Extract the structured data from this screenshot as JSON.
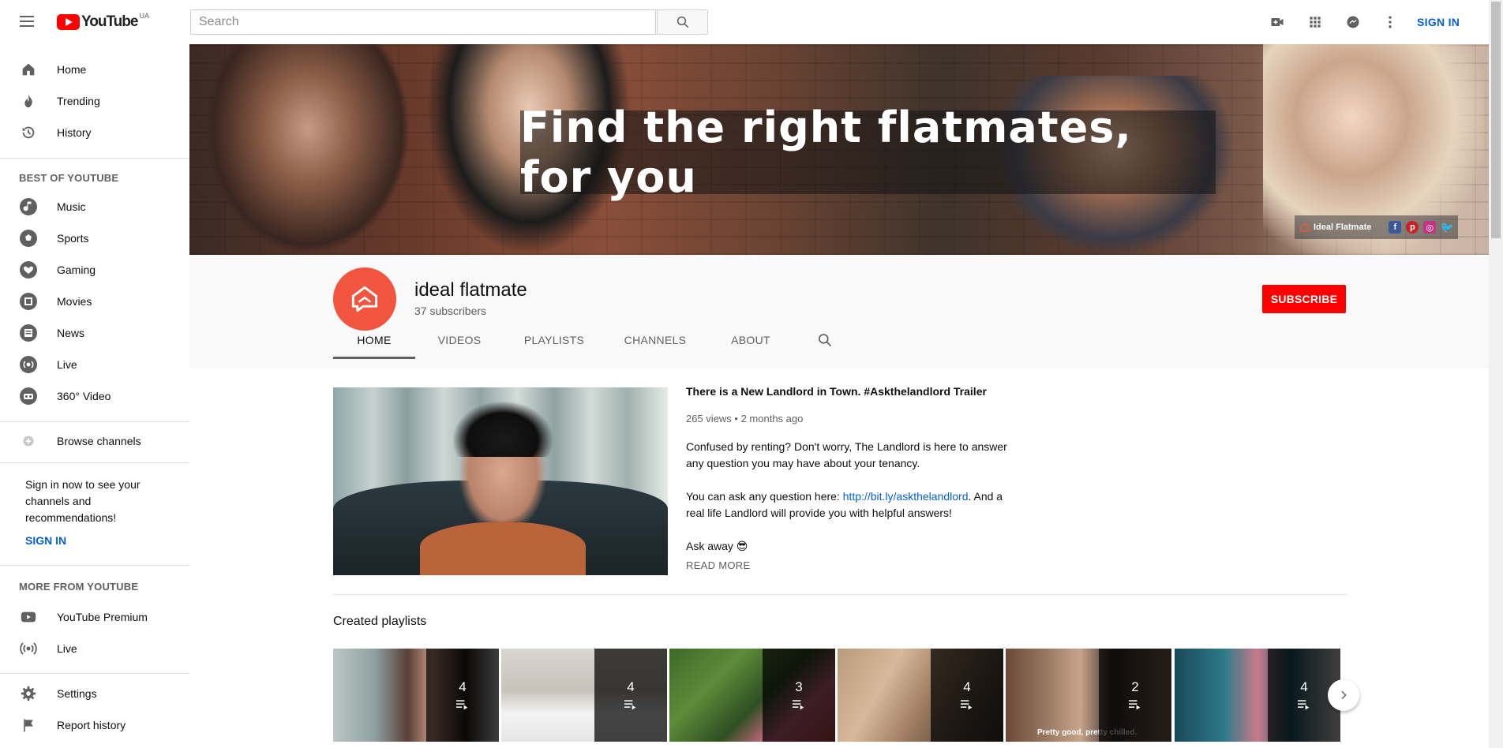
{
  "header": {
    "logo_text": "YouTube",
    "country_code": "UA",
    "search_placeholder": "Search",
    "sign_in": "SIGN IN",
    "icons": [
      "menu-icon",
      "search-icon",
      "create-video-icon",
      "apps-icon",
      "messages-icon",
      "more-vert-icon"
    ]
  },
  "sidebar": {
    "main": [
      {
        "label": "Home",
        "icon": "home-icon"
      },
      {
        "label": "Trending",
        "icon": "trending-icon"
      },
      {
        "label": "History",
        "icon": "history-icon"
      }
    ],
    "best_heading": "BEST OF YOUTUBE",
    "best": [
      {
        "label": "Music",
        "icon": "music-icon"
      },
      {
        "label": "Sports",
        "icon": "sports-icon"
      },
      {
        "label": "Gaming",
        "icon": "gaming-icon"
      },
      {
        "label": "Movies",
        "icon": "movies-icon"
      },
      {
        "label": "News",
        "icon": "news-icon"
      },
      {
        "label": "Live",
        "icon": "live-icon"
      },
      {
        "label": "360° Video",
        "icon": "vr-icon"
      }
    ],
    "browse": {
      "label": "Browse channels",
      "icon": "add-circle-icon"
    },
    "signin_promo": "Sign in now to see your channels and recommendations!",
    "signin_label": "SIGN IN",
    "more_heading": "MORE FROM YOUTUBE",
    "more": [
      {
        "label": "YouTube Premium",
        "icon": "youtube-premium-icon"
      },
      {
        "label": "Live",
        "icon": "broadcast-icon"
      }
    ],
    "bottom": [
      {
        "label": "Settings",
        "icon": "settings-icon"
      },
      {
        "label": "Report history",
        "icon": "flag-icon"
      }
    ]
  },
  "banner": {
    "title": "Find the right flatmates, for you",
    "link_label": "Ideal Flatmate",
    "social": [
      "facebook-icon",
      "pinterest-icon",
      "instagram-icon",
      "twitter-icon"
    ]
  },
  "channel": {
    "name": "ideal flatmate",
    "subscribers": "37 subscribers",
    "subscribe_label": "SUBSCRIBE",
    "tabs": [
      "HOME",
      "VIDEOS",
      "PLAYLISTS",
      "CHANNELS",
      "ABOUT"
    ],
    "active_tab": "HOME"
  },
  "featured": {
    "title": "There is a New Landlord in Town. #Askthelandlord Trailer",
    "meta": "265 views • 2 months ago",
    "desc_p1": "Confused by renting? Don't worry, The Landlord is here to answer any question you may have about your tenancy.",
    "desc_p2_prefix": "You can ask any question here: ",
    "desc_p2_link": "http://bit.ly/askthelandlord",
    "desc_p2_suffix": ". And a real life Landlord will provide you with helpful answers!",
    "desc_p3": "Ask away 😎",
    "read_more": "READ MORE"
  },
  "playlists": {
    "heading": "Created playlists",
    "items": [
      {
        "count": "4"
      },
      {
        "count": "4"
      },
      {
        "count": "3"
      },
      {
        "count": "4"
      },
      {
        "count": "2",
        "caption": "Pretty good, pretty chilled."
      },
      {
        "count": "4"
      }
    ]
  },
  "colors": {
    "accent_red": "#ff0000",
    "link_blue": "#065fd4",
    "avatar": "#f1543f"
  }
}
